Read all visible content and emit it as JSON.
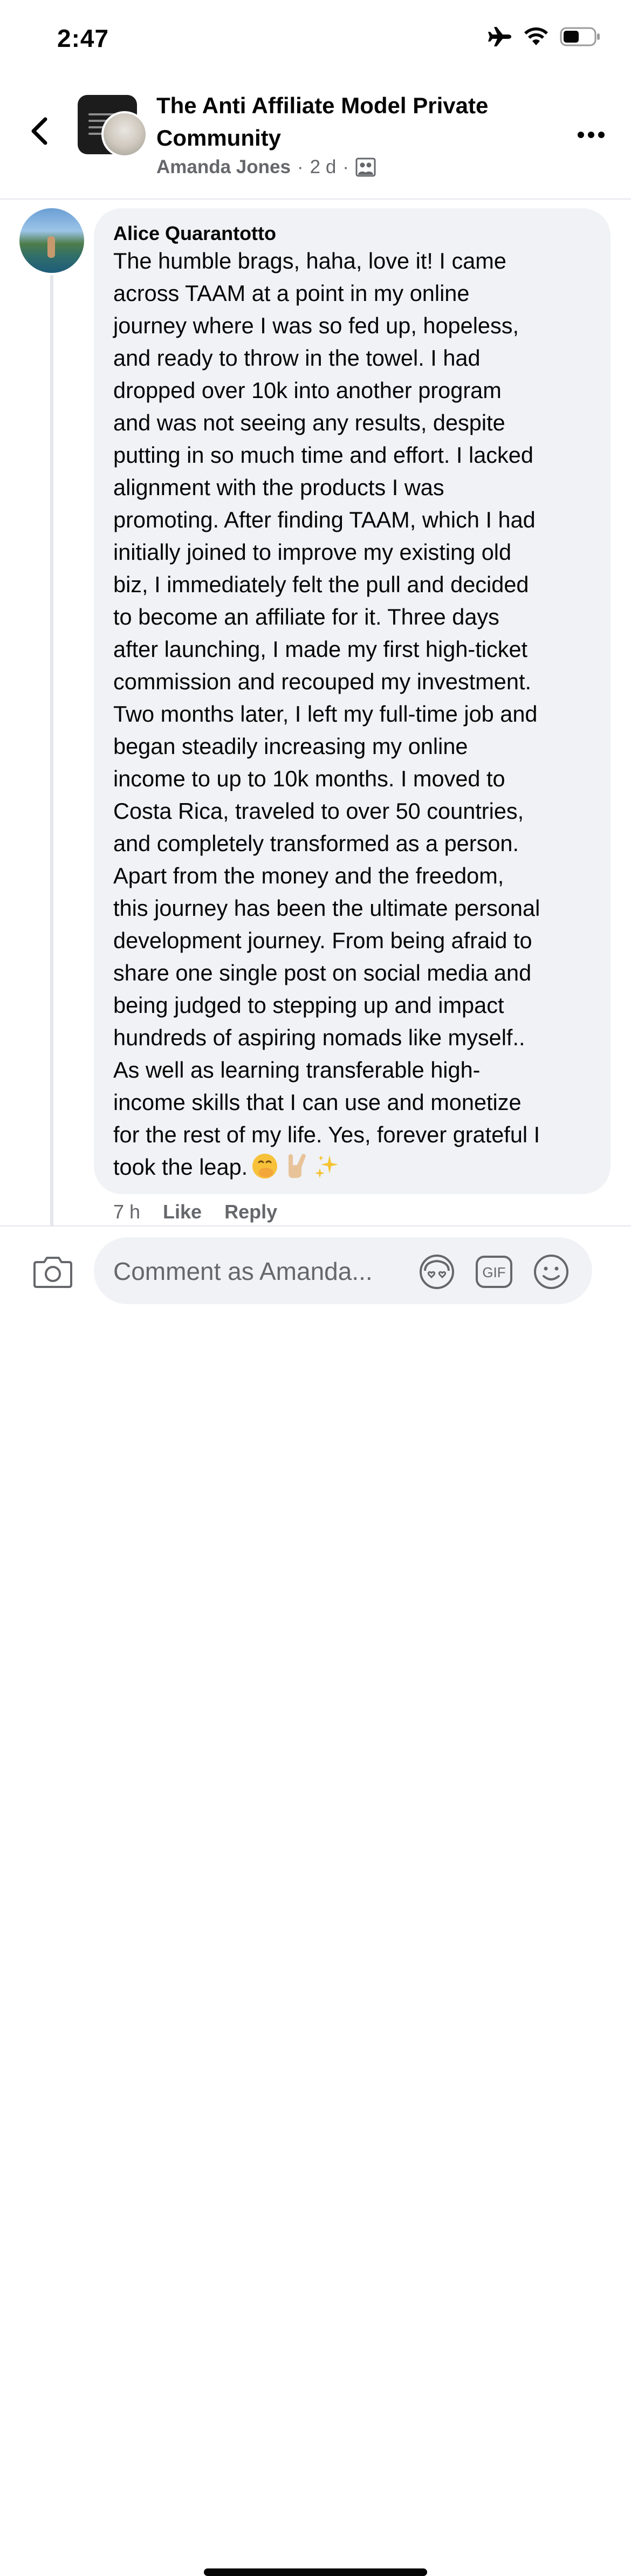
{
  "status_bar": {
    "time": "2:47",
    "icons": [
      "airplane-icon",
      "wifi-icon",
      "battery-icon"
    ]
  },
  "header": {
    "title": "The Anti Affiliate Model Private Community",
    "author": "Amanda Jones",
    "separator": "·",
    "age": "2 d",
    "privacy_icon": "members-icon"
  },
  "comment": {
    "author": "Alice Quarantotto",
    "text": "The humble brags, haha, love it! I came\nacross TAAM at a point in my online\njourney where I was so fed up, hopeless,\nand ready to throw in the towel. I had\ndropped over 10k into another program\nand was not seeing any results, despite\nputting in so much time and effort. I lacked\nalignment with the products I was\npromoting. After finding TAAM, which I had\ninitially joined to improve my existing old\nbiz, I immediately felt the pull and decided\nto become an affiliate for it. Three days\nafter launching, I made my first high-ticket\ncommission and recouped my investment.\nTwo months later, I left my full-time job and\nbegan steadily increasing my online\nincome to up to 10k months. I moved to\nCosta Rica, traveled to over 50 countries,\nand completely transformed as a person.\nApart from the money and the freedom,\nthis journey has been the ultimate personal\ndevelopment journey. From being afraid to\nshare one single post on social media and\nbeing judged to stepping up and impact\nhundreds of aspiring nomads like myself..\nAs well as learning transferable high-\nincome skills that I can use and monetize\nfor the rest of my life. Yes, forever grateful I\ntook the leap.",
    "emojis": [
      "face-with-hand-over-mouth-emoji",
      "love-you-gesture-emoji",
      "sparkles-emoji"
    ],
    "time": "7 h",
    "like_label": "Like",
    "reply_label": "Reply"
  },
  "composer": {
    "placeholder": "Comment as Amanda...",
    "icons": [
      "camera-icon",
      "avatar-sticker-icon",
      "gif-icon",
      "emoji-icon"
    ],
    "gif_label": "GIF"
  },
  "colors": {
    "bubble": "#f0f2f5",
    "secondary_text": "#65676b",
    "primary_text": "#050505"
  }
}
